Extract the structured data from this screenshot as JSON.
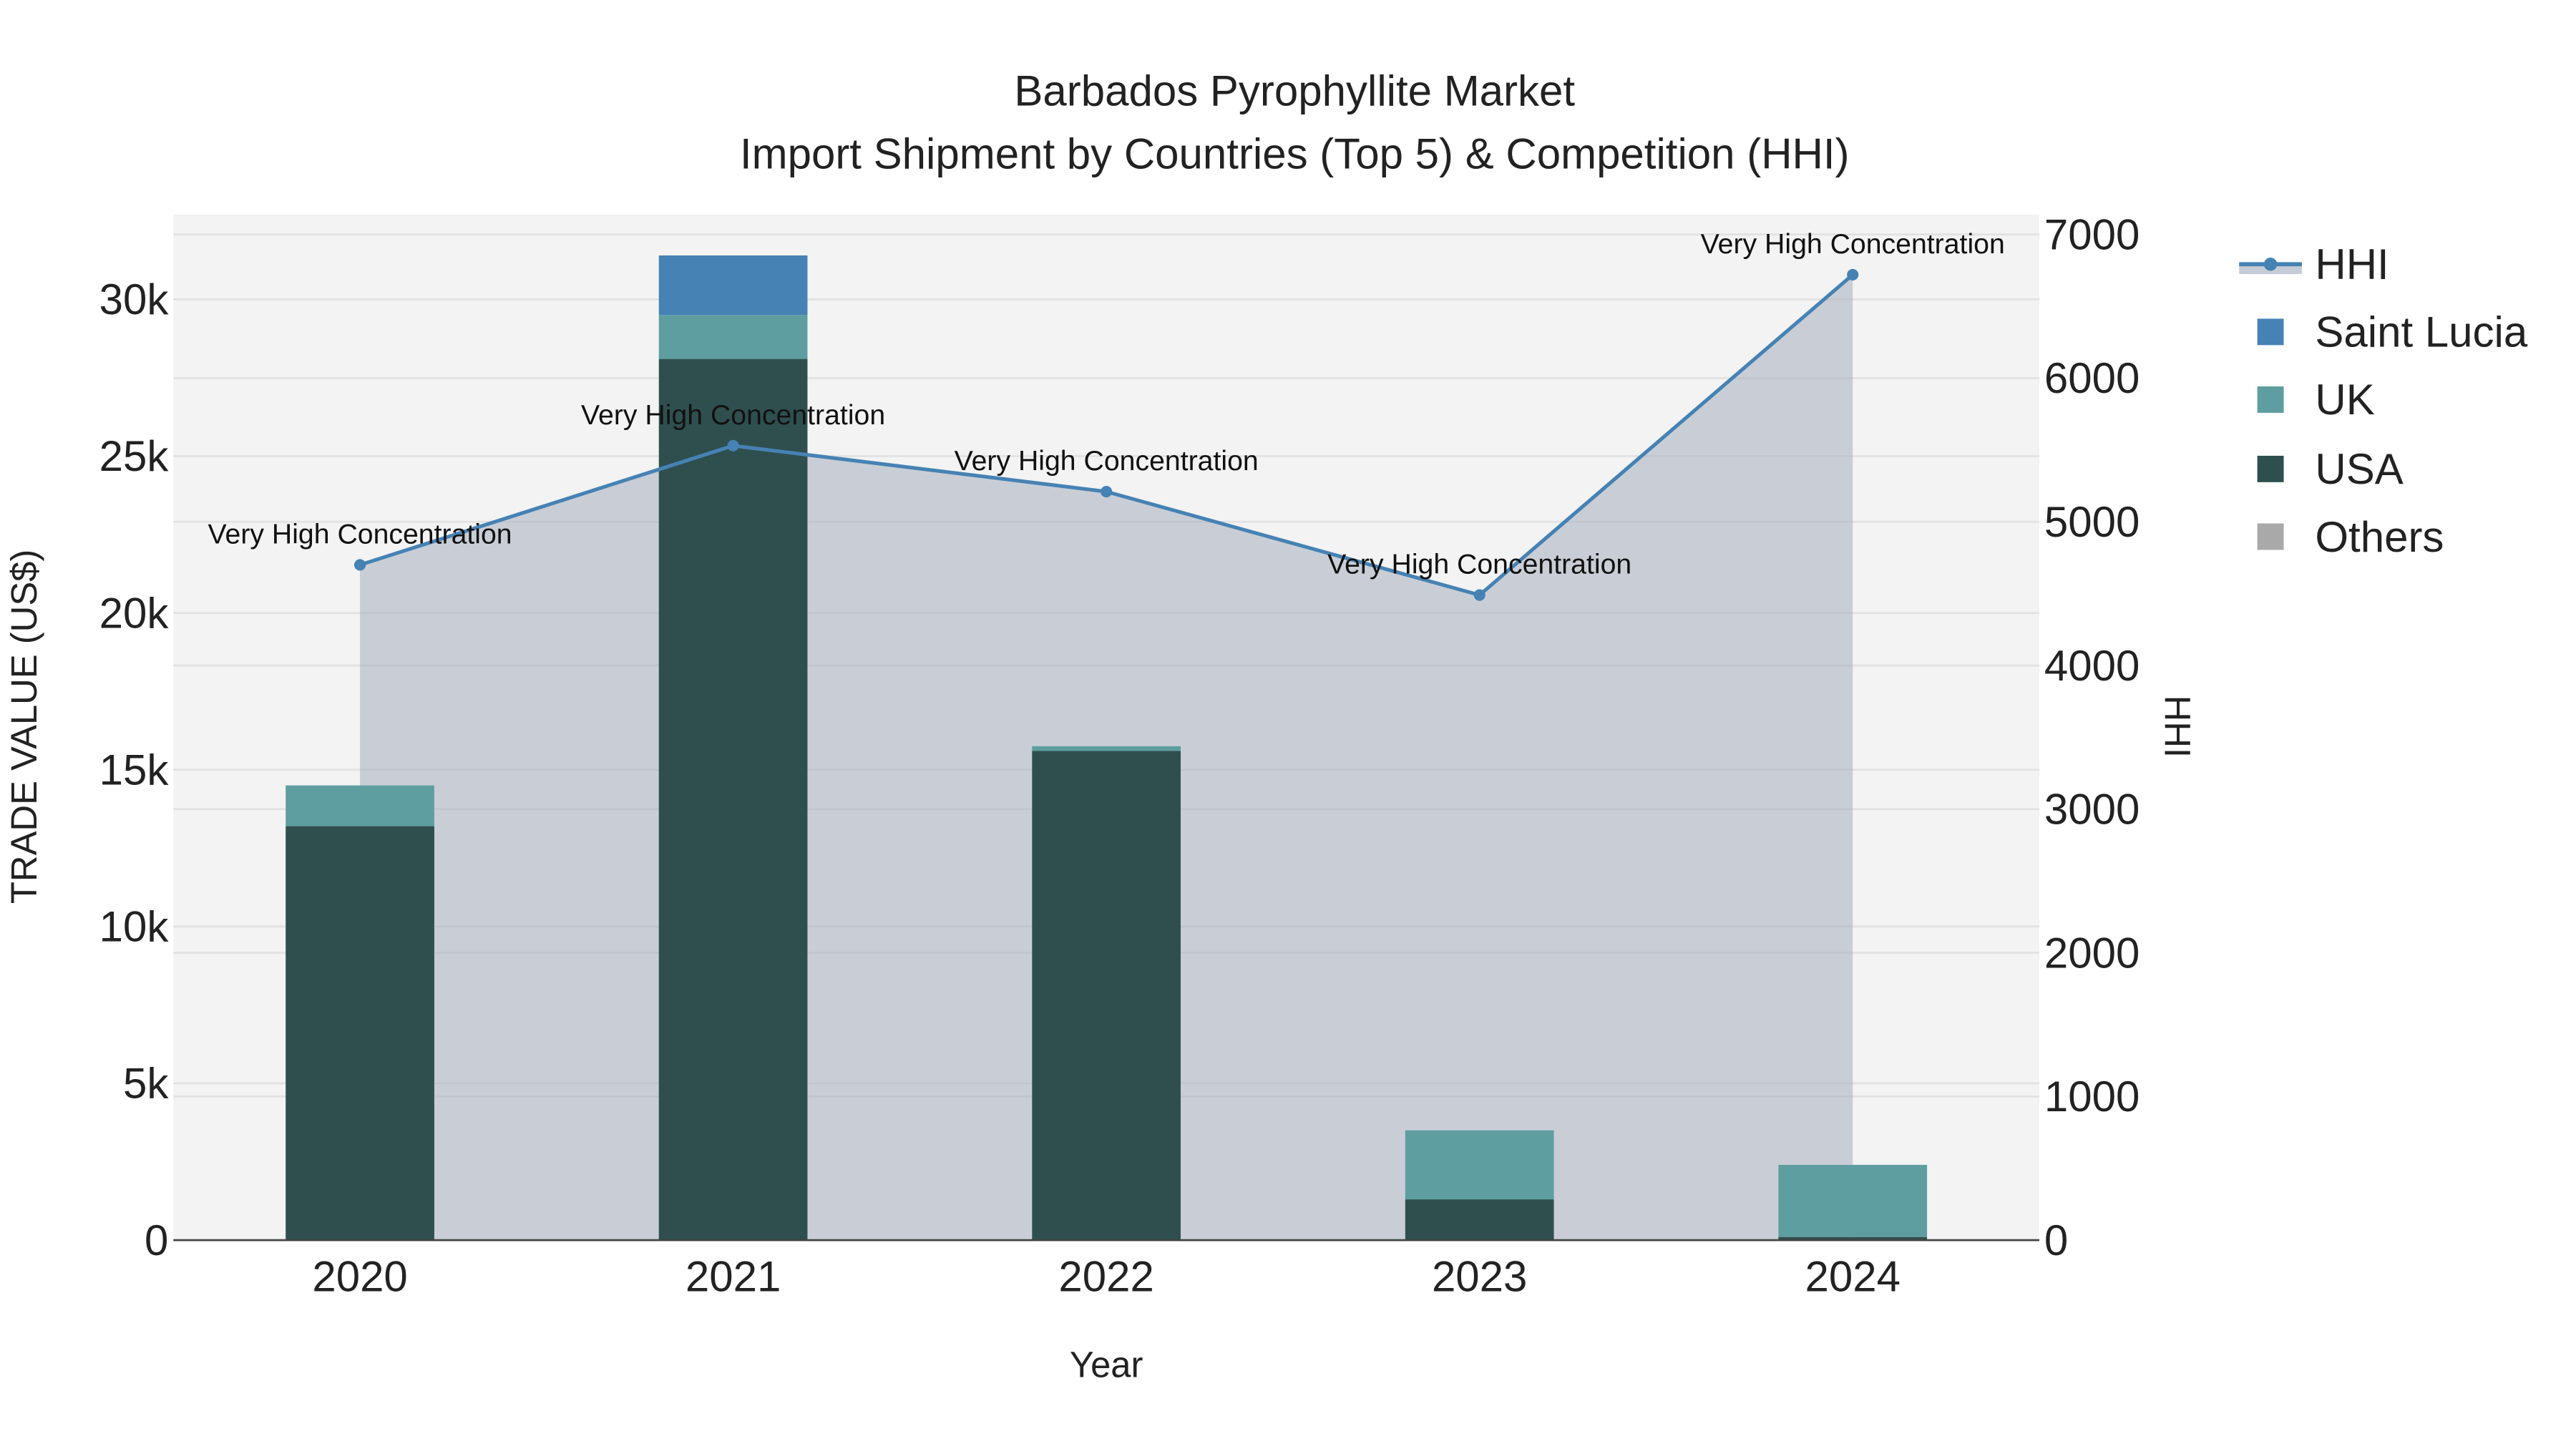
{
  "chart_data": {
    "type": "bar",
    "title": "Barbados Pyrophyllite Market",
    "subtitle": "Import Shipment by Countries (Top 5) & Competition (HHI)",
    "xlabel": "Year",
    "ylabel": "TRADE VALUE (US$)",
    "y2label": "HHI",
    "categories": [
      "2020",
      "2021",
      "2022",
      "2023",
      "2024"
    ],
    "ylim": [
      0,
      32700
    ],
    "y2lim": [
      0,
      7000
    ],
    "yticks": [
      0,
      5000,
      10000,
      15000,
      20000,
      25000,
      30000
    ],
    "ytick_labels": [
      "0",
      "5k",
      "10k",
      "15k",
      "20k",
      "25k",
      "30k"
    ],
    "y2ticks": [
      0,
      1000,
      2000,
      3000,
      4000,
      5000,
      6000,
      7000
    ],
    "y2tick_labels": [
      "0",
      "1000",
      "2000",
      "3000",
      "4000",
      "5000",
      "6000",
      "7000"
    ],
    "series": [
      {
        "name": "USA",
        "color": "#2f4f4f",
        "values": [
          13200,
          28100,
          15600,
          1300,
          100
        ]
      },
      {
        "name": "UK",
        "color": "#5f9ea0",
        "values": [
          1300,
          1400,
          150,
          2200,
          2300
        ]
      },
      {
        "name": "Saint Lucia",
        "color": "#4682b4",
        "values": [
          0,
          1900,
          0,
          0,
          0
        ]
      },
      {
        "name": "Others",
        "color": "#a9a9a9",
        "values": [
          0,
          0,
          0,
          0,
          0
        ]
      }
    ],
    "hhi": {
      "name": "HHI",
      "color": "#4682b4",
      "values": [
        4700,
        5530,
        5210,
        4490,
        6720
      ],
      "labels": [
        "Very High Concentration",
        "Very High Concentration",
        "Very High Concentration",
        "Very High Concentration",
        "Very High Concentration"
      ]
    },
    "legend": [
      "HHI",
      "Saint Lucia",
      "UK",
      "USA",
      "Others"
    ],
    "legend_position": "right",
    "grid": true
  }
}
